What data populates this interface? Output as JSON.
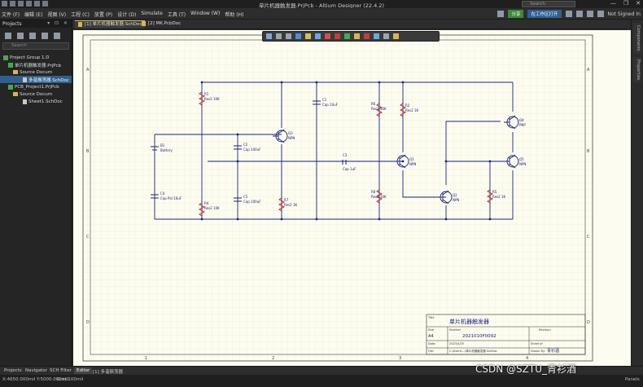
{
  "window": {
    "title": "单片机器触发器.PrjPcb - Altium Designer (22.4.2)",
    "search_placeholder": "Search",
    "controls": [
      "—",
      "❐",
      "✕"
    ]
  },
  "menus": [
    "文件 (F)",
    "编辑 (E)",
    "视图 (V)",
    "工程 (C)",
    "放置 (P)",
    "设计 (D)",
    "Simulate",
    "工具 (T)",
    "Window (W)",
    "帮助 (H)"
  ],
  "menubar_right": {
    "share": "分享",
    "open_space": "在工作区打开",
    "user": "Not Signed In"
  },
  "panel": {
    "title": "Projects",
    "controls": "▾ ⊡ ✕",
    "search_placeholder": "Search",
    "tree": [
      {
        "label": "Project Group 1.D",
        "indent": 4,
        "kind": "proj",
        "selected": false
      },
      {
        "label": "单片机器触发器.PrjPcb",
        "indent": 10,
        "kind": "proj",
        "selected": false
      },
      {
        "label": "Source Docum",
        "indent": 16,
        "kind": "folder",
        "selected": false
      },
      {
        "label": "多谐振荡器.SchDoc",
        "indent": 28,
        "kind": "doc",
        "selected": true
      },
      {
        "label": "PCB_Project1.PrjPcb",
        "indent": 10,
        "kind": "proj",
        "selected": false
      },
      {
        "label": "Source Docum",
        "indent": 16,
        "kind": "folder",
        "selected": false
      },
      {
        "label": "Sheet1.SchDoc",
        "indent": 28,
        "kind": "doc",
        "selected": false
      }
    ]
  },
  "tabs": [
    {
      "label": "[1] 单片机器触发器.SchDoc",
      "active": true
    },
    {
      "label": "[2] MK.PcbDoc",
      "active": false
    }
  ],
  "sidebar_tabs": [
    "Components",
    "Properties"
  ],
  "bottom_tabs": [
    {
      "label": "Projects",
      "active": false
    },
    {
      "label": "Navigator",
      "active": false
    },
    {
      "label": "SCH Filter",
      "active": false
    },
    {
      "label": "Editor",
      "active": true
    },
    {
      "label": "[1] 多谐振荡器",
      "active": false
    }
  ],
  "status": {
    "coords": "X:4650.000mil Y:5000.000mil",
    "grid": "Grid:100mil",
    "panels": "Panels"
  },
  "sheet": {
    "row_labels": [
      "A",
      "B",
      "C",
      "D"
    ],
    "col_labels": [
      "1",
      "2",
      "3",
      "4"
    ],
    "title_block": {
      "title_label": "Title",
      "title_value": "单片机器触发器",
      "size_label": "Size",
      "size_value": "A4",
      "number_label": "Number",
      "number_value": "2021010F0092",
      "revision_label": "Revision",
      "date_label": "Date:",
      "date_value": "2023/4/20",
      "file_label": "File:",
      "file_value": "C:\\Users\\...\\单片机器触发器.SchDoc",
      "sheet_label": "Sheet of",
      "drawn_label": "Drawn By:",
      "drawn_value": "青衫酒"
    }
  },
  "components": [
    {
      "ref": "R1",
      "value": "Res2 10K"
    },
    {
      "ref": "R2",
      "value": "Res2 1K"
    },
    {
      "ref": "R3",
      "value": "Res2 10K"
    },
    {
      "ref": "R4",
      "value": "Res2 10K"
    },
    {
      "ref": "R5",
      "value": "Res2 1K"
    },
    {
      "ref": "R6",
      "value": "Res2 10K"
    },
    {
      "ref": "R7",
      "value": "Res2 1K"
    },
    {
      "ref": "R8",
      "value": "Res2 10K"
    },
    {
      "ref": "C1",
      "value": "Cap 10uF"
    },
    {
      "ref": "C2",
      "value": "Cap 100uF"
    },
    {
      "ref": "C3",
      "value": "Cap 1uF"
    },
    {
      "ref": "C4",
      "value": "Cap Pol 10uF"
    },
    {
      "ref": "C5",
      "value": "Cap 100uF"
    },
    {
      "ref": "Q1",
      "value": "NPN"
    },
    {
      "ref": "Q2",
      "value": "NPN"
    },
    {
      "ref": "Q3",
      "value": "NPN"
    },
    {
      "ref": "Q4",
      "value": "PNP"
    },
    {
      "ref": "Q5",
      "value": "NPN"
    },
    {
      "ref": "B1",
      "value": "Battery"
    }
  ],
  "watermark": "CSDN @SZTU_青衫酒"
}
